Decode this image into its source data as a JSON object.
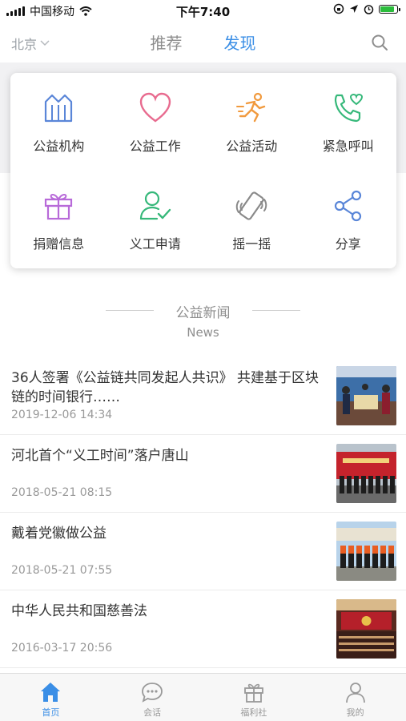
{
  "status_bar": {
    "carrier": "中国移动",
    "time": "下午7:40",
    "battery_level": 0.9
  },
  "header": {
    "city": "北京",
    "tabs": [
      {
        "label": "推荐",
        "active": false
      },
      {
        "label": "发现",
        "active": true
      }
    ]
  },
  "menu": {
    "items": [
      {
        "label": "公益机构",
        "icon": "building-icon",
        "color": "#5a86d8"
      },
      {
        "label": "公益工作",
        "icon": "heart-icon",
        "color": "#e86b8f"
      },
      {
        "label": "公益活动",
        "icon": "runner-icon",
        "color": "#f19a3e"
      },
      {
        "label": "紧急呼叫",
        "icon": "phone-heart-icon",
        "color": "#36b87a"
      },
      {
        "label": "捐赠信息",
        "icon": "gift-icon",
        "color": "#b86ad9"
      },
      {
        "label": "义工申请",
        "icon": "user-check-icon",
        "color": "#36b87a"
      },
      {
        "label": "摇一摇",
        "icon": "shake-phone-icon",
        "color": "#8a8a8a"
      },
      {
        "label": "分享",
        "icon": "share-icon",
        "color": "#5a86d8"
      }
    ]
  },
  "news": {
    "title": "公益新闻",
    "subtitle": "News",
    "items": [
      {
        "title": "36人签署《公益链共同发起人共识》 共建基于区块链的时间银行……",
        "date": "2019-12-06 14:34"
      },
      {
        "title": "河北首个“义工时间”落户唐山",
        "date": "2018-05-21 08:15"
      },
      {
        "title": "戴着党徽做公益",
        "date": "2018-05-21 07:55"
      },
      {
        "title": "中华人民共和国慈善法",
        "date": "2016-03-17 20:56"
      }
    ]
  },
  "tabbar": {
    "items": [
      {
        "label": "首页",
        "icon": "home-icon",
        "active": true
      },
      {
        "label": "会话",
        "icon": "chat-icon",
        "active": false
      },
      {
        "label": "福利社",
        "icon": "gift-icon",
        "active": false
      },
      {
        "label": "我的",
        "icon": "person-icon",
        "active": false
      }
    ]
  },
  "colors": {
    "accent": "#3a8ee6",
    "inactive": "#999999"
  }
}
